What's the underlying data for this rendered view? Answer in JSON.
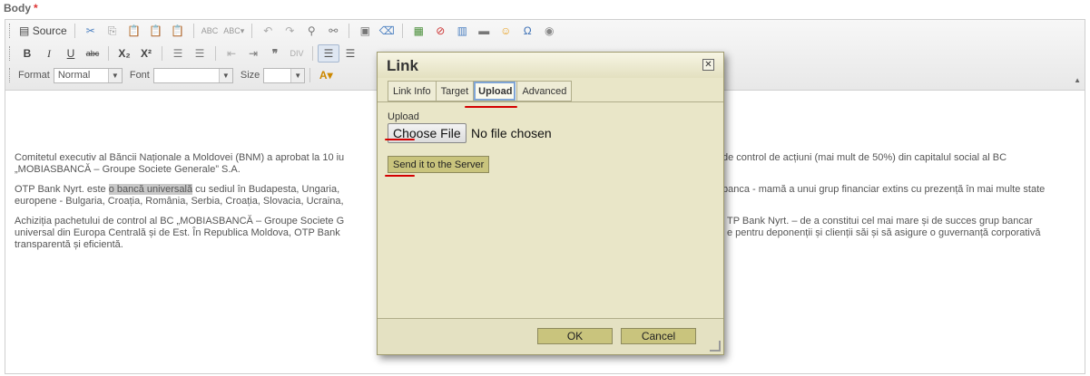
{
  "field": {
    "label": "Body",
    "required_mark": "*"
  },
  "toolbar": {
    "source_label": "Source",
    "format_label": "Format",
    "format_value": "Normal",
    "font_label": "Font",
    "font_value": "",
    "size_label": "Size",
    "size_value": "",
    "row1_icons": [
      "source-icon",
      "cut-icon",
      "copy-icon",
      "paste-icon",
      "paste-text-icon",
      "paste-word-icon",
      "spellcheck-icon",
      "spellcheck-menu-icon",
      "undo-icon",
      "redo-icon",
      "find-icon",
      "replace-icon",
      "select-all-icon",
      "remove-format-icon",
      "image-icon",
      "flash-icon",
      "table-icon",
      "horizontal-rule-icon",
      "smiley-icon",
      "special-char-icon",
      "page-break-icon"
    ],
    "row2_buttons": [
      {
        "name": "bold",
        "glyph": "B"
      },
      {
        "name": "italic",
        "glyph": "I"
      },
      {
        "name": "underline",
        "glyph": "U"
      },
      {
        "name": "strike",
        "glyph": "abc"
      },
      {
        "name": "subscript",
        "glyph": "X₂"
      },
      {
        "name": "superscript",
        "glyph": "X²"
      }
    ]
  },
  "content": {
    "para1_a": "Comitetul executiv al Băncii Naționale a Moldovei (BNM) a aprobat la 10 iu",
    "para1_b": "de control de acțiuni  (mai mult de 50%) din capitalul social al BC",
    "para1_c": "„MOBIASBANCĂ – Groupe Societe Generale” S.A.",
    "para2_a1": "OTP Bank Nyrt. este ",
    "para2_hl": "o bancă universală",
    "para2_a2": " cu sediul în Budapesta, Ungaria,",
    "para2_b": "banca - mamă a unui grup financiar extins cu prezență în mai multe state",
    "para2_c": "europene - Bulgaria, Croația, România, Serbia, Croația, Slovacia, Ucraina,",
    "para3_a": "Achiziția pachetului de control al BC „MOBIASBANCĂ – Groupe Societe G",
    "para3_b": "TP Bank Nyrt. – de a constitui cel mai mare și de succes grup bancar",
    "para3_c": "universal din Europa Centrală și de Est. În Republica Moldova, OTP Bank",
    "para3_d": "e pentru deponenții și clienții săi și să asigure o guvernanță corporativă",
    "para3_e": "transparentă și eficientă."
  },
  "dialog": {
    "title": "Link",
    "close_glyph": "✕",
    "tabs": [
      "Link Info",
      "Target",
      "Upload",
      "Advanced"
    ],
    "active_tab": "Upload",
    "upload_label": "Upload",
    "choose_file": "Choose File",
    "no_file": "No file chosen",
    "send_button": "Send it to the Server",
    "ok_button": "OK",
    "cancel_button": "Cancel"
  },
  "colors": {
    "dialog_bg": "#e9e6c8",
    "button_bg": "#c9c47d",
    "annotation_red": "#d40000",
    "active_tab_outline": "#7fa5d6"
  }
}
